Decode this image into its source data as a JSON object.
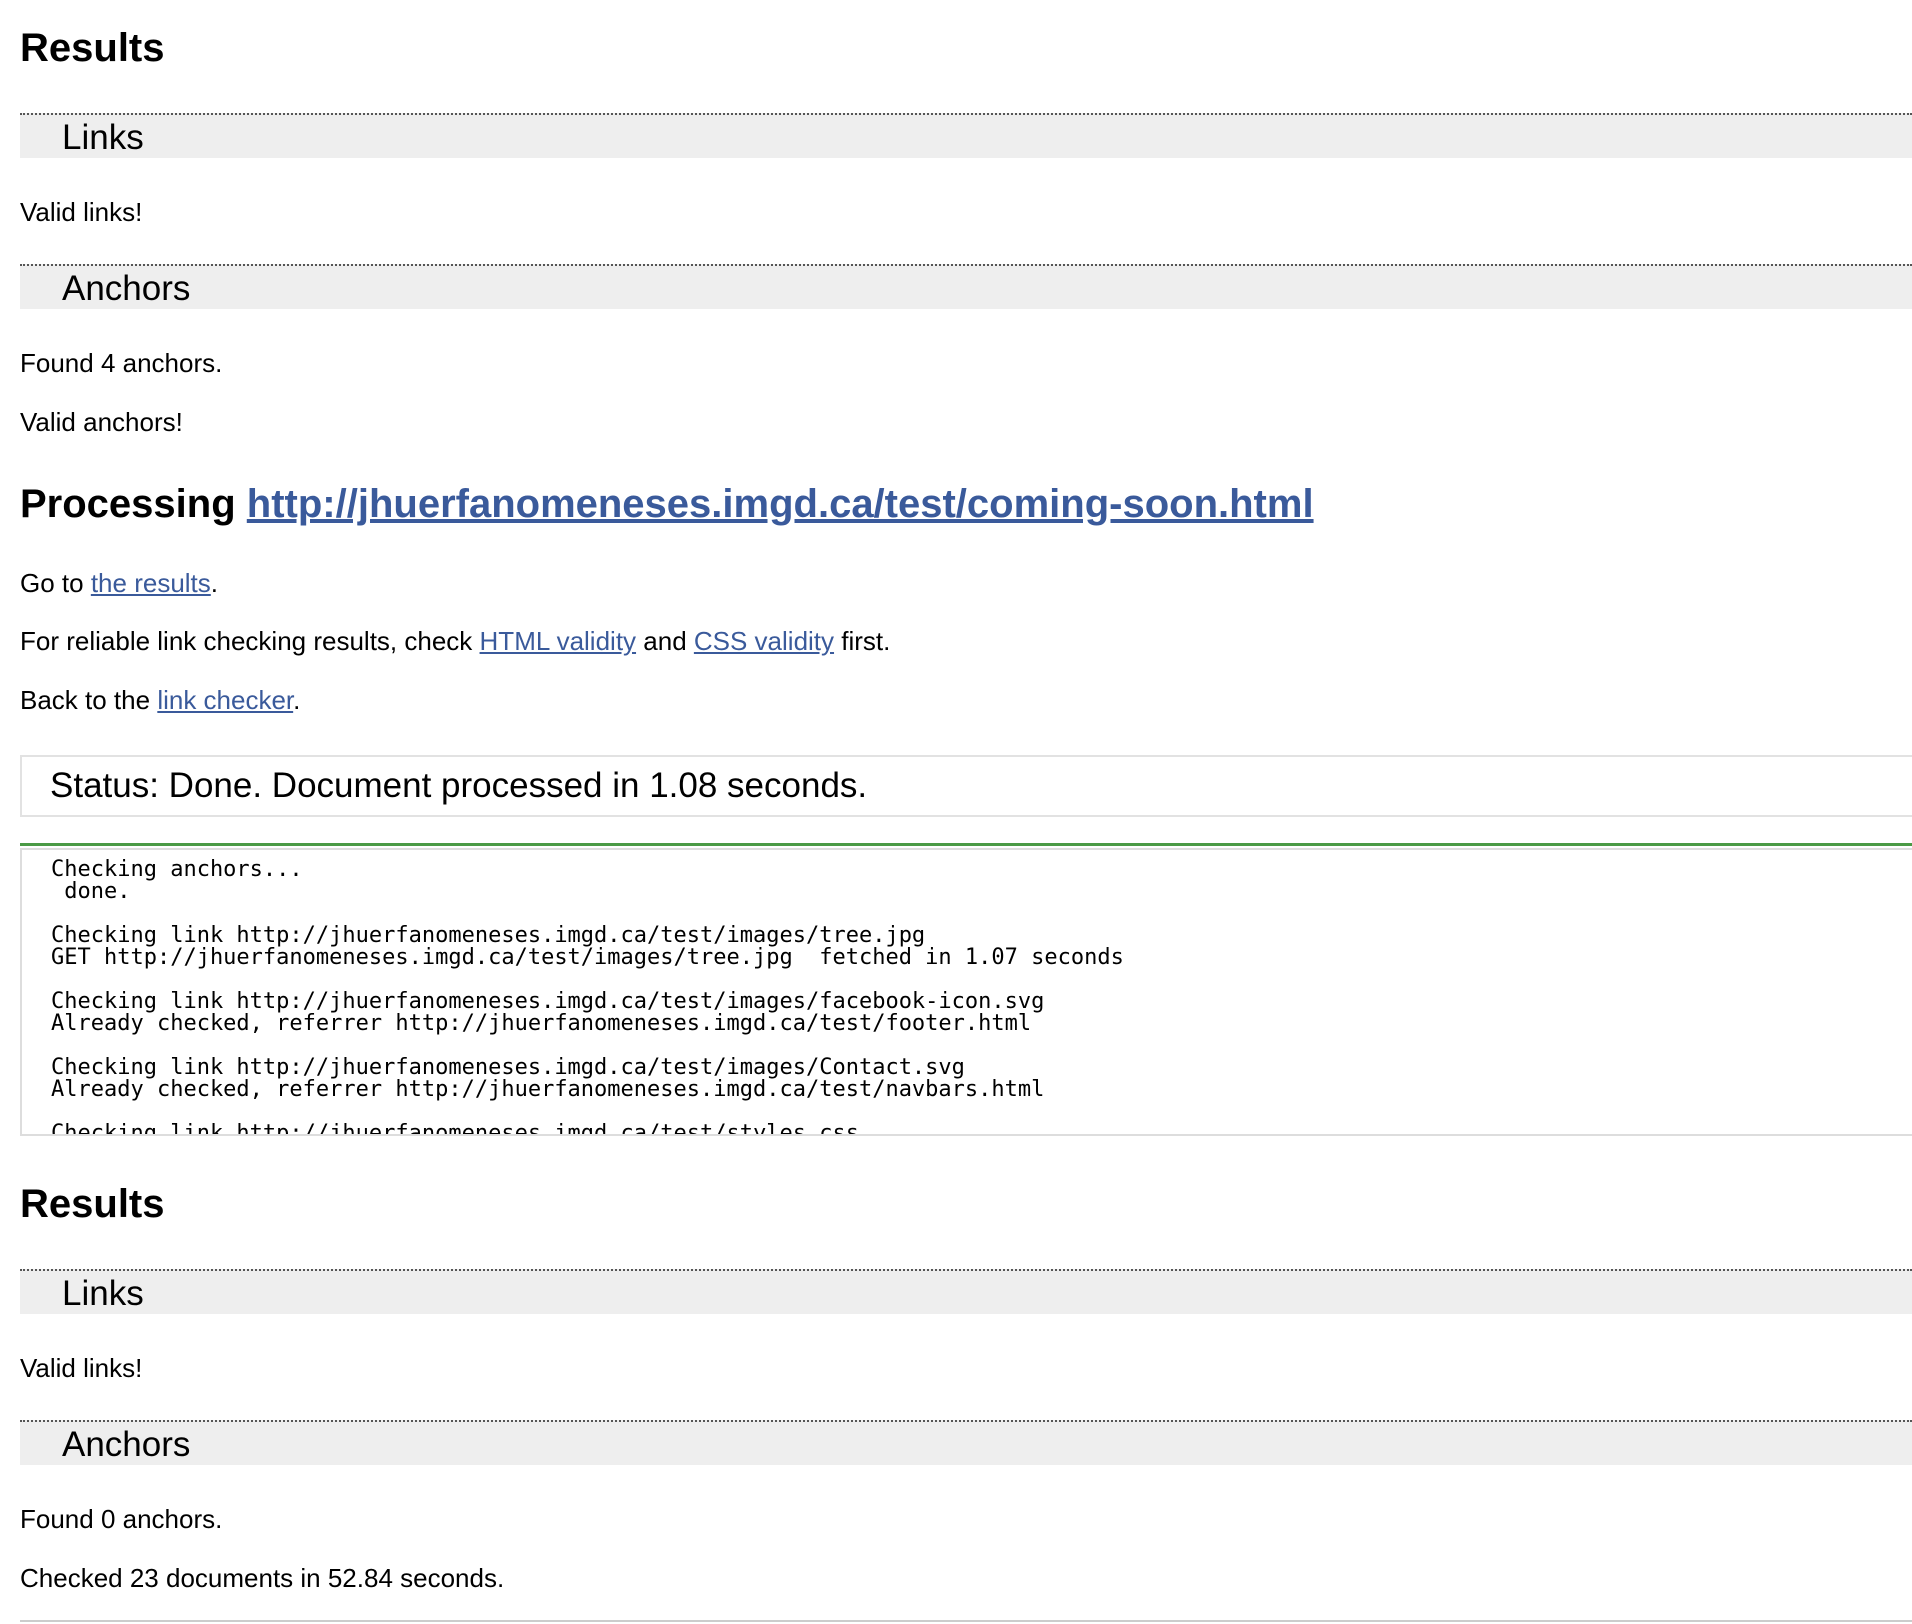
{
  "first_results": {
    "heading": "Results",
    "links_section": {
      "title": "Links",
      "message": "Valid links!"
    },
    "anchors_section": {
      "title": "Anchors",
      "found": "Found 4 anchors.",
      "message": "Valid anchors!"
    }
  },
  "processing": {
    "prefix": "Processing",
    "url": "http://jhuerfanomeneses.imgd.ca/test/coming-soon.html",
    "goto_prefix": "Go to ",
    "goto_link": "the results",
    "goto_suffix": ".",
    "reliable_prefix": "For reliable link checking results, check ",
    "html_validity_link": "HTML validity",
    "reliable_and": " and ",
    "css_validity_link": "CSS validity",
    "reliable_suffix": " first.",
    "back_prefix": "Back to the ",
    "link_checker_link": "link checker",
    "back_suffix": "."
  },
  "status": {
    "text": "Status: Done. Document processed in 1.08 seconds."
  },
  "log": {
    "text": "Checking anchors...\n done.\n\nChecking link http://jhuerfanomeneses.imgd.ca/test/images/tree.jpg\nGET http://jhuerfanomeneses.imgd.ca/test/images/tree.jpg  fetched in 1.07 seconds\n\nChecking link http://jhuerfanomeneses.imgd.ca/test/images/facebook-icon.svg\nAlready checked, referrer http://jhuerfanomeneses.imgd.ca/test/footer.html\n\nChecking link http://jhuerfanomeneses.imgd.ca/test/images/Contact.svg\nAlready checked, referrer http://jhuerfanomeneses.imgd.ca/test/navbars.html\n\nChecking link http://jhuerfanomeneses.imgd.ca/test/styles.css"
  },
  "second_results": {
    "heading": "Results",
    "links_section": {
      "title": "Links",
      "message": "Valid links!"
    },
    "anchors_section": {
      "title": "Anchors",
      "found": "Found 0 anchors."
    },
    "summary": "Checked 23 documents in 52.84 seconds."
  },
  "colors": {
    "link": "#3a5a9b",
    "section_bar": "#eeeeee",
    "status_rule": "#4a9a45"
  }
}
